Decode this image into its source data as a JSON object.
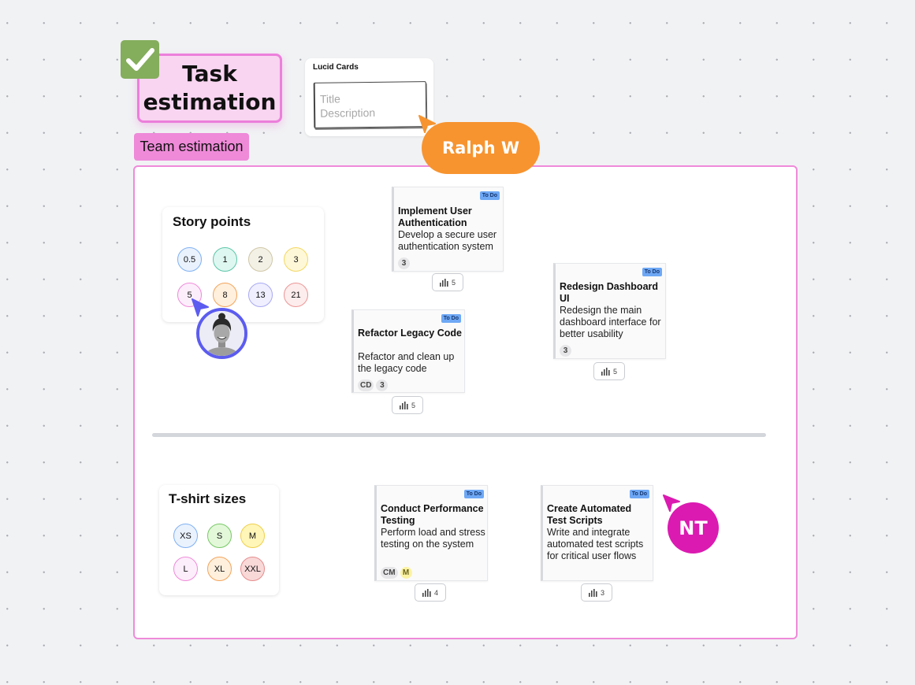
{
  "header": {
    "title": "Task estimation",
    "title_line1": "Task",
    "title_line2": "estimation",
    "checkmark_icon": "check-icon",
    "section_tag": "Team estimation"
  },
  "lucid_cards": {
    "title": "Lucid Cards",
    "placeholder_title": "Title",
    "placeholder_description": "Description"
  },
  "collaborators": [
    {
      "name": "Ralph W",
      "color": "#f7942f"
    },
    {
      "name": "NT",
      "color": "#db1ab1"
    },
    {
      "name": "avatar-user",
      "color": "#5c5cf0"
    }
  ],
  "story_points": {
    "title": "Story points",
    "chips": [
      {
        "label": "0.5",
        "bg": "#eaf2fe",
        "border": "#7fb0f2"
      },
      {
        "label": "1",
        "bg": "#def7f1",
        "border": "#5cc6a7"
      },
      {
        "label": "2",
        "bg": "#f3f1e6",
        "border": "#cfc6a6"
      },
      {
        "label": "3",
        "bg": "#fff8d8",
        "border": "#f3d761"
      },
      {
        "label": "5",
        "bg": "#fdeefb",
        "border": "#ef8ad9"
      },
      {
        "label": "8",
        "bg": "#fff0de",
        "border": "#f2a35a"
      },
      {
        "label": "13",
        "bg": "#efefff",
        "border": "#a9a9f2"
      },
      {
        "label": "21",
        "bg": "#fdeded",
        "border": "#ec9494"
      }
    ]
  },
  "tshirt_sizes": {
    "title": "T-shirt sizes",
    "chips": [
      {
        "label": "XS",
        "bg": "#eaf2fe",
        "border": "#7fb0f2"
      },
      {
        "label": "S",
        "bg": "#e3f8d9",
        "border": "#77c866"
      },
      {
        "label": "M",
        "bg": "#fff6b8",
        "border": "#efcf4b"
      },
      {
        "label": "L",
        "bg": "#fdeefb",
        "border": "#ef8ad9"
      },
      {
        "label": "XL",
        "bg": "#fff0de",
        "border": "#f2a35a"
      },
      {
        "label": "XXL",
        "bg": "#f9d8d8",
        "border": "#e58c8c"
      }
    ]
  },
  "tasks": [
    {
      "status": "To Do",
      "title": "Implement User Authentication",
      "description": "Develop a secure user authentication system",
      "tags": [
        {
          "label": "3",
          "style": "gray"
        }
      ],
      "votes": "5"
    },
    {
      "status": "To Do",
      "title": "Refactor Legacy Code",
      "description": "Refactor and clean up the legacy code",
      "tags": [
        {
          "label": "CD",
          "style": "gray"
        },
        {
          "label": "3",
          "style": "gray"
        }
      ],
      "votes": "5"
    },
    {
      "status": "To Do",
      "title": "Redesign Dashboard UI",
      "description": "Redesign the main dashboard interface for better usability",
      "tags": [
        {
          "label": "3",
          "style": "gray"
        }
      ],
      "votes": "5"
    },
    {
      "status": "To Do",
      "title": "Conduct Performance Testing",
      "description": "Perform load and stress testing on the system",
      "tags": [
        {
          "label": "CM",
          "style": "gray"
        },
        {
          "label": "M",
          "style": "yellow"
        }
      ],
      "votes": "4"
    },
    {
      "status": "To Do",
      "title": "Create Automated Test Scripts",
      "description": "Write and integrate automated test scripts for critical user flows",
      "tags": [],
      "votes": "3"
    }
  ],
  "colors": {
    "frame_border": "#ef8ad9",
    "status_badge": "#6ea8f5",
    "sticker_green": "#84ad5c"
  }
}
